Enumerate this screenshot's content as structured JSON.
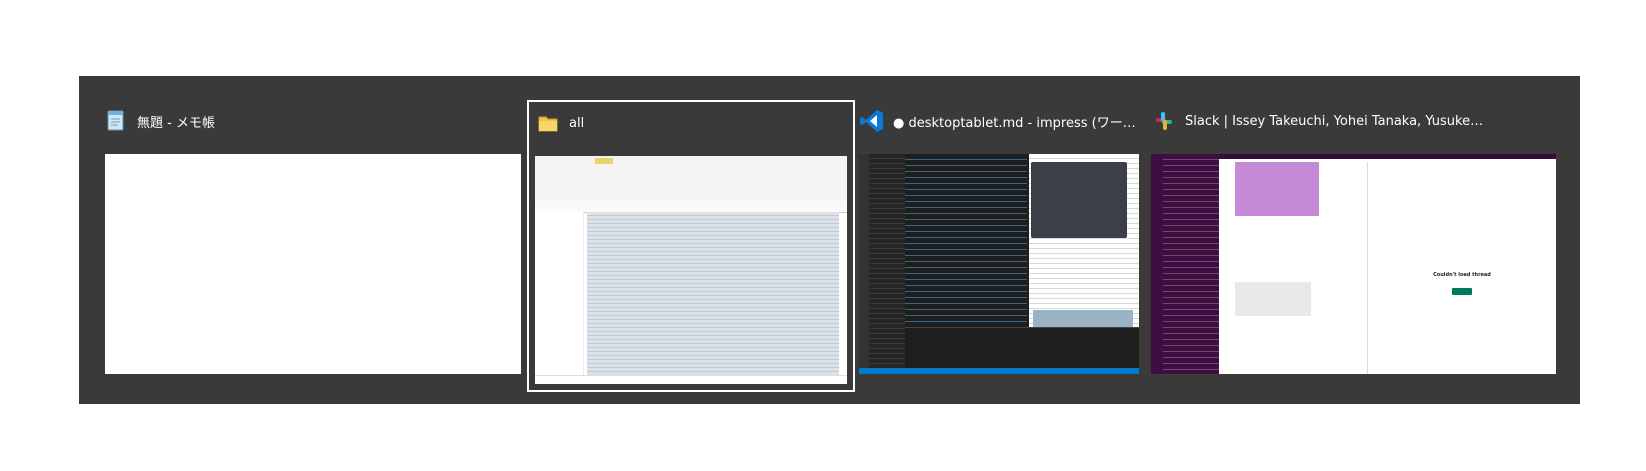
{
  "task_switcher": {
    "windows": [
      {
        "title": "無題 - メモ帳",
        "icon": "notepad-icon",
        "selected": false
      },
      {
        "title": "all",
        "icon": "folder-icon",
        "selected": true
      },
      {
        "title": "● desktoptablet.md - impress (ワークスペース...",
        "icon": "vscode-icon",
        "selected": false
      },
      {
        "title": "Slack | Issey Takeuchi, Yohei Tanaka, Yusuke Kuroka...",
        "icon": "slack-icon",
        "selected": false
      }
    ],
    "slack_thread_message": "Couldn't load thread"
  },
  "colors": {
    "switcher_bg": "#3a3a3a",
    "selection_border": "#ffffff",
    "vscode_blue": "#007acc",
    "slack_purple": "#3f0e40"
  }
}
